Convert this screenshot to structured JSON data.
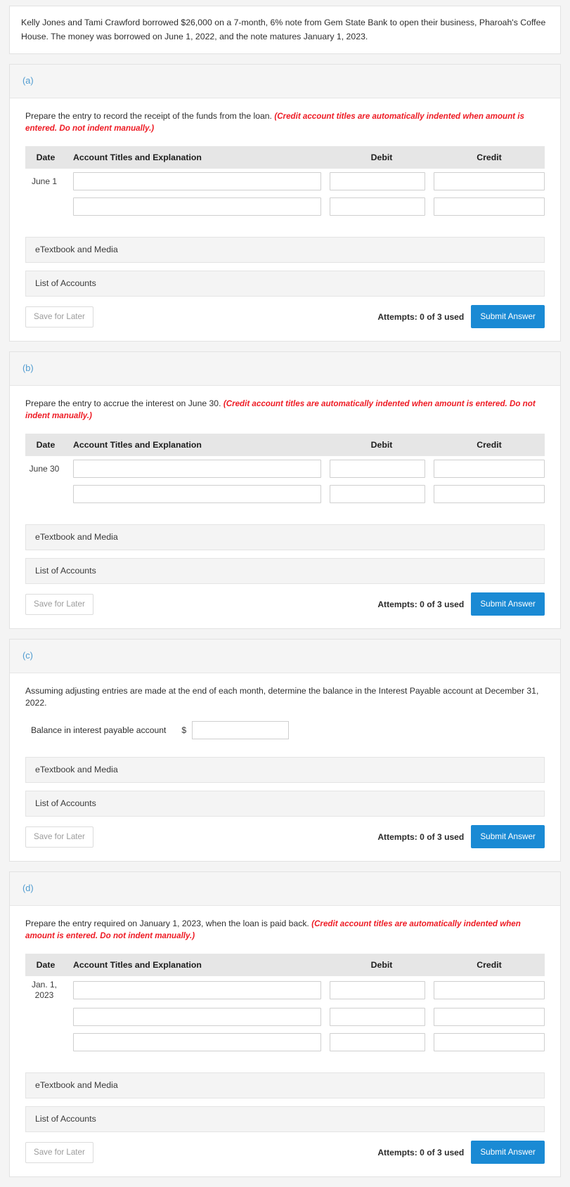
{
  "intro": {
    "text": "Kelly Jones and Tami Crawford borrowed $26,000 on a 7-month, 6% note from Gem State Bank to open their business, Pharoah's Coffee House. The money was borrowed on June 1, 2022, and the note matures January 1, 2023."
  },
  "common": {
    "table_headers": {
      "date": "Date",
      "account": "Account Titles and Explanation",
      "debit": "Debit",
      "credit": "Credit"
    },
    "etextbook_label": "eTextbook and Media",
    "list_of_accounts_label": "List of Accounts",
    "save_for_later_label": "Save for Later",
    "attempts_label": "Attempts: 0 of 3 used",
    "submit_label": "Submit Answer",
    "hint_text": "(Credit account titles are automatically indented when amount is entered. Do not indent manually.)",
    "field_value": "",
    "accent_blue": "#1a8ad4",
    "letter_blue": "#4f9bd0",
    "hint_red": "#ee1b24"
  },
  "parts": [
    {
      "letter": "(a)",
      "prompt_main": "Prepare the entry to record the receipt of the funds from the loan.",
      "has_hint": true,
      "rows": [
        {
          "date": "June 1",
          "account": "",
          "debit": "",
          "credit": ""
        },
        {
          "date": "",
          "account": "",
          "debit": "",
          "credit": ""
        }
      ]
    },
    {
      "letter": "(b)",
      "prompt_main": "Prepare the entry to accrue the interest on June 30.",
      "has_hint": true,
      "rows": [
        {
          "date": "June 30",
          "account": "",
          "debit": "",
          "credit": ""
        },
        {
          "date": "",
          "account": "",
          "debit": "",
          "credit": ""
        }
      ]
    },
    {
      "letter": "(c)",
      "prompt_main": "Assuming adjusting entries are made at the end of each month, determine the balance in the Interest Payable account at December 31, 2022.",
      "has_hint": false,
      "balance": {
        "label": "Balance in interest payable account",
        "currency_symbol": "$",
        "value": ""
      }
    },
    {
      "letter": "(d)",
      "prompt_main": "Prepare the entry required on January 1, 2023, when the loan is paid back.",
      "has_hint": true,
      "rows": [
        {
          "date": "Jan. 1, 2023",
          "account": "",
          "debit": "",
          "credit": ""
        },
        {
          "date": "",
          "account": "",
          "debit": "",
          "credit": ""
        },
        {
          "date": "",
          "account": "",
          "debit": "",
          "credit": ""
        }
      ]
    }
  ]
}
